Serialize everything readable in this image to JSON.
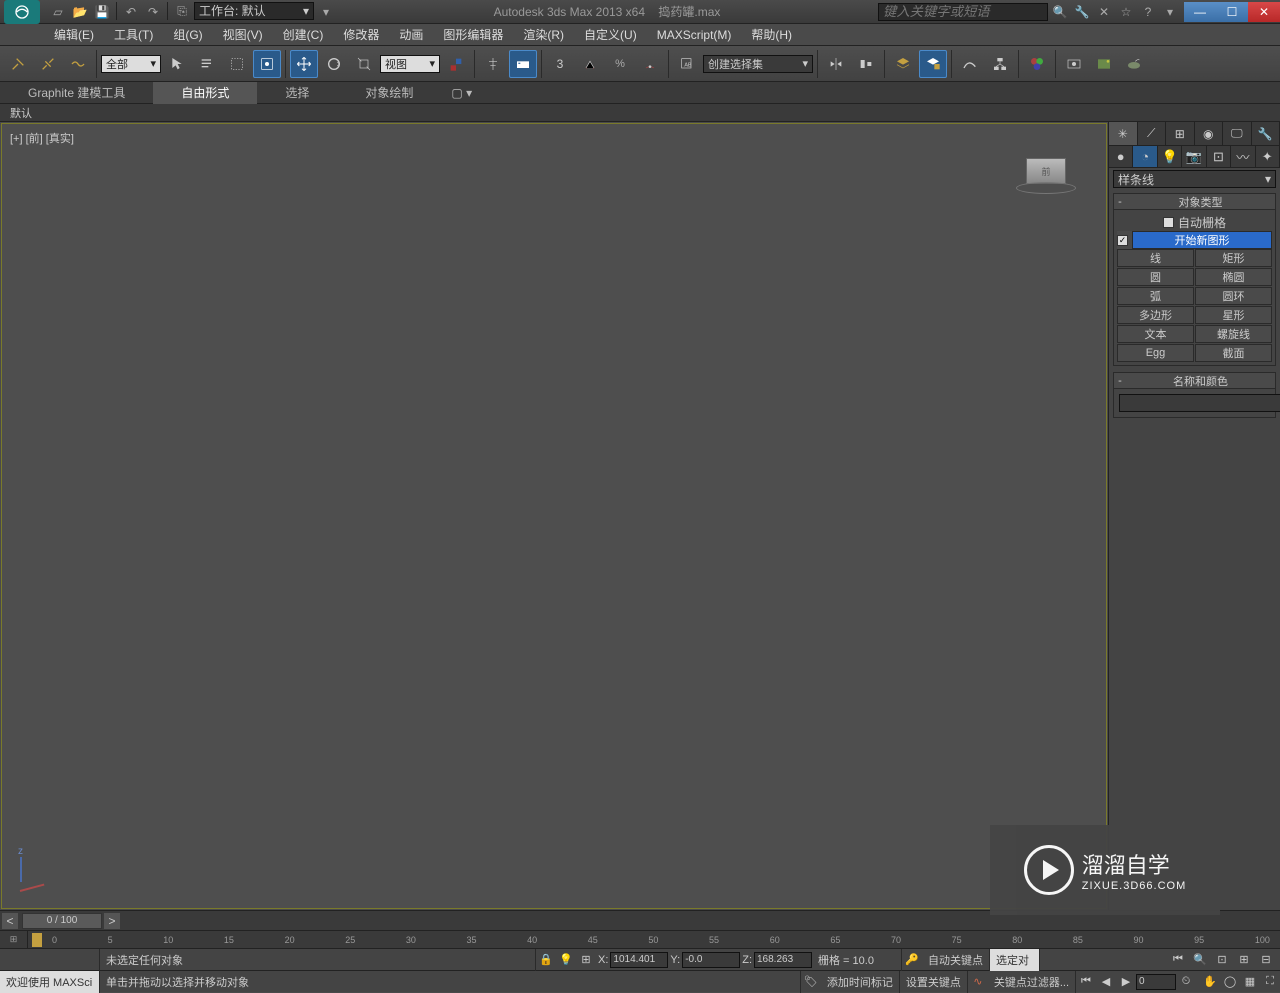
{
  "title": {
    "app": "Autodesk 3ds Max  2013 x64",
    "file": "捣药罐.max"
  },
  "workspace": "工作台: 默认",
  "search_placeholder": "键入关键字或短语",
  "menu": [
    "编辑(E)",
    "工具(T)",
    "组(G)",
    "视图(V)",
    "创建(C)",
    "修改器",
    "动画",
    "图形编辑器",
    "渲染(R)",
    "自定义(U)",
    "MAXScript(M)",
    "帮助(H)"
  ],
  "toolbar": {
    "filter": "全部",
    "view_dd": "视图",
    "named_set": "创建选择集"
  },
  "ribbon": {
    "tabs": [
      "Graphite 建模工具",
      "自由形式",
      "选择",
      "对象绘制"
    ],
    "sub": "默认"
  },
  "viewport": {
    "label": "[+] [前] [真实]",
    "cube_face": "前"
  },
  "panel": {
    "category": "样条线",
    "rollout1": "对象类型",
    "auto_grid": "自动栅格",
    "start_new": "开始新图形",
    "buttons": [
      [
        "线",
        "矩形"
      ],
      [
        "圆",
        "椭圆"
      ],
      [
        "弧",
        "圆环"
      ],
      [
        "多边形",
        "星形"
      ],
      [
        "文本",
        "螺旋线"
      ],
      [
        "Egg",
        "截面"
      ]
    ],
    "rollout2": "名称和颜色"
  },
  "timeslider": {
    "frame": "0 / 100",
    "ticks": [
      "0",
      "5",
      "10",
      "15",
      "20",
      "25",
      "30",
      "35",
      "40",
      "45",
      "50",
      "55",
      "60",
      "65",
      "70",
      "75",
      "80",
      "85",
      "90",
      "95",
      "100"
    ]
  },
  "status": {
    "sel": "未选定任何对象",
    "x": "1014.401",
    "y": "-0.0",
    "z": "168.263",
    "grid": "栅格 = 10.0",
    "autokey": "自动关键点",
    "selfilter": "选定对"
  },
  "prompt": {
    "welcome": "欢迎使用  MAXSci",
    "hint": "单击并拖动以选择并移动对象",
    "addtag": "添加时间标记",
    "setkey": "设置关键点",
    "keyfilter": "关键点过滤器...",
    "framein": "0"
  },
  "watermark": {
    "cn": "溜溜自学",
    "en": "ZIXUE.3D66.COM"
  }
}
